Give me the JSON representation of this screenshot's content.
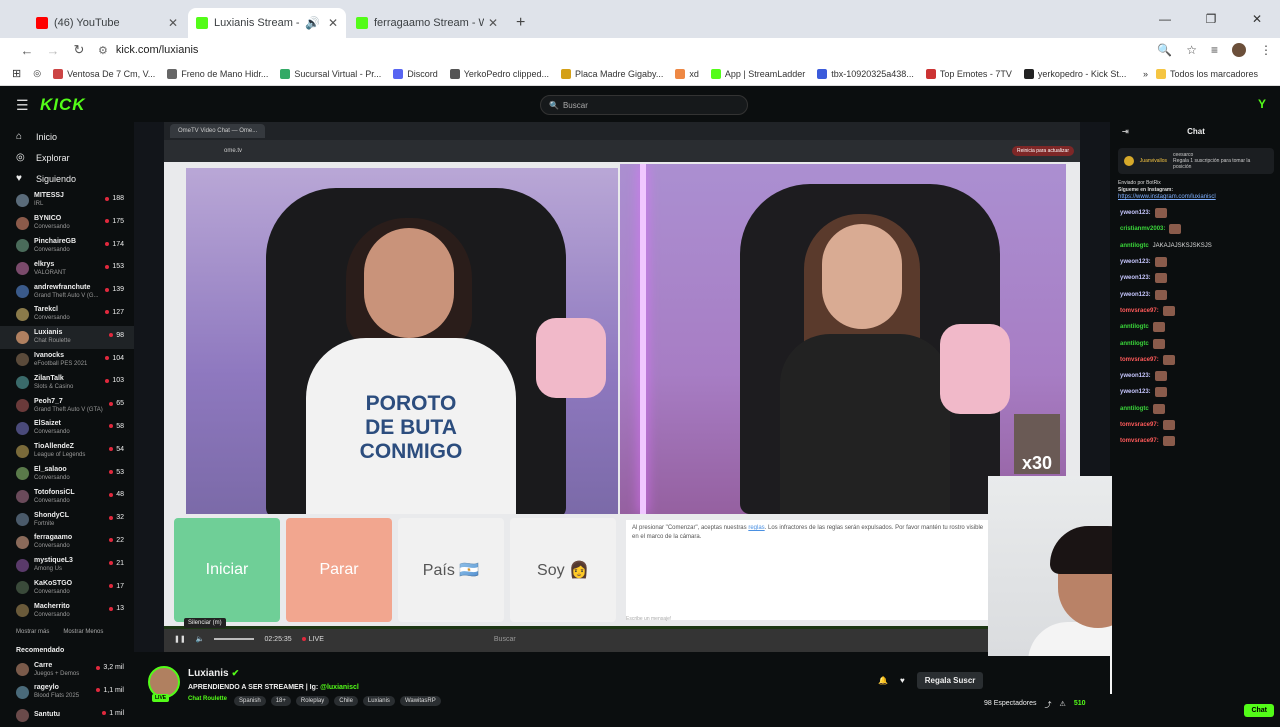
{
  "tabs": [
    {
      "label": "(46) YouTube",
      "color": "#ff0000"
    },
    {
      "label": "Luxianis Stream - Watch Live",
      "color": "#53fc18"
    },
    {
      "label": "ferragaamo Stream - Watch Live",
      "color": "#53fc18"
    }
  ],
  "toolbar": {
    "url": "kick.com/luxianis"
  },
  "bookmarks": [
    "Ventosa De 7 Cm, V...",
    "Freno de Mano Hidr...",
    "Sucursal Virtual - Pr...",
    "Discord",
    "YerkoPedro clipped...",
    "Placa Madre Gigaby...",
    "xd",
    "App | StreamLadder",
    "tbx-10920325a438...",
    "Top Emotes - 7TV",
    "yerkopedro - Kick St..."
  ],
  "bookmarks_all": "Todos los marcadores",
  "kick": {
    "logo": "KICK",
    "search_placeholder": "Buscar"
  },
  "sidebar": {
    "nav": [
      {
        "label": "Inicio",
        "icon": "⌂"
      },
      {
        "label": "Explorar",
        "icon": "◎"
      },
      {
        "label": "Siguiendo",
        "icon": "♥"
      }
    ],
    "channels": [
      {
        "name": "MITESSJ",
        "cat": "IRL",
        "viewers": "188",
        "color": "#5a6b7a"
      },
      {
        "name": "BYNICO",
        "cat": "Conversando",
        "viewers": "175",
        "color": "#8b5a4a"
      },
      {
        "name": "PinchaireGB",
        "cat": "Conversando",
        "viewers": "174",
        "color": "#4a6b5a"
      },
      {
        "name": "elkrys",
        "cat": "VALORANT",
        "viewers": "153",
        "color": "#7a4a6b"
      },
      {
        "name": "andrewfranchute",
        "cat": "Grand Theft Auto V (G...",
        "viewers": "139",
        "color": "#3a5a8a"
      },
      {
        "name": "Tarekcl",
        "cat": "Conversando",
        "viewers": "127",
        "color": "#8a7a4a"
      },
      {
        "name": "Luxianis",
        "cat": "Chat Roulette",
        "viewers": "98",
        "color": "#b08060"
      },
      {
        "name": "Ivanocks",
        "cat": "eFootball PES 2021",
        "viewers": "104",
        "color": "#5a4a3a"
      },
      {
        "name": "ZilanTalk",
        "cat": "Slots & Casino",
        "viewers": "103",
        "color": "#3a6a6a"
      },
      {
        "name": "Peoh7_7",
        "cat": "Grand Theft Auto V (GTA)",
        "viewers": "65",
        "color": "#6a3a3a"
      },
      {
        "name": "ElSaizet",
        "cat": "Conversando",
        "viewers": "58",
        "color": "#4a4a7a"
      },
      {
        "name": "TioAllendeZ",
        "cat": "League of Legends",
        "viewers": "54",
        "color": "#7a6a3a"
      },
      {
        "name": "El_salaoo",
        "cat": "Conversando",
        "viewers": "53",
        "color": "#5a7a4a"
      },
      {
        "name": "TotofonsiCL",
        "cat": "Conversando",
        "viewers": "48",
        "color": "#6a4a5a"
      },
      {
        "name": "ShondyCL",
        "cat": "Fortnite",
        "viewers": "32",
        "color": "#4a5a6a"
      },
      {
        "name": "ferragaamo",
        "cat": "Conversando",
        "viewers": "22",
        "color": "#8a6a5a"
      },
      {
        "name": "mystiqueL3",
        "cat": "Among Us",
        "viewers": "21",
        "color": "#5a3a6a"
      },
      {
        "name": "KaKoSTGO",
        "cat": "Conversando",
        "viewers": "17",
        "color": "#3a4a3a"
      },
      {
        "name": "Macherrito",
        "cat": "Conversando",
        "viewers": "13",
        "color": "#6a5a3a"
      }
    ],
    "show_more": "Mostrar más",
    "show_less": "Mostrar Menos",
    "recommended_title": "Recomendado",
    "recommended": [
      {
        "name": "Carre",
        "cat": "Juegos + Demos",
        "viewers": "3,2 mil",
        "color": "#7a5a4a"
      },
      {
        "name": "rageylo",
        "cat": "Blood Flats 2025",
        "viewers": "1,1 mil",
        "color": "#4a6a7a"
      },
      {
        "name": "Santutu",
        "cat": "",
        "viewers": "1 mil",
        "color": "#6a4a4a"
      }
    ]
  },
  "video": {
    "inner_tab": "OmeTV Video Chat — Ome...",
    "inner_url": "ome.tv",
    "inner_pill": "Reinicia para actualizar",
    "hoodie": "POROTO\nDE BUTA\nCONMIGO",
    "x30": "x30",
    "buttons": {
      "start": "Iniciar",
      "stop": "Parar",
      "country": "País 🇦🇷",
      "me": "Soy 👩"
    },
    "notice_a": "Al presionar \"Comenzar\", aceptas nuestras ",
    "notice_link": "reglas",
    "notice_b": ". Los infractores de las reglas serán expulsados. Por favor mantén tu rostro visible en el marco de la cámara.",
    "msg_placeholder": "Escribe un mensaje!",
    "tooltip": "Silenciar (m)",
    "time": "02:25:35",
    "live": "LIVE",
    "taskbar_search": "Buscar",
    "progress": 0.9
  },
  "stream": {
    "name": "Luxianis",
    "live": "LIVE",
    "title": "APRENDIENDO A SER STREAMER | Ig: ",
    "ig": "@luxianiscl",
    "category": "Chat Roulette",
    "tags": [
      "Spanish",
      "18+",
      "Roleplay",
      "Chile",
      "Luxianis",
      "WawitasRP"
    ],
    "gift": "Regala Suscr",
    "viewers": "98 Espectadores",
    "likes": "510"
  },
  "chat": {
    "title": "Chat",
    "sub_user": "Juanvivallos",
    "sub_user2": "ceesarco",
    "sub_text": "Regala 1 suscripción para tomar la posición",
    "pinned_by": "Enviado por  BotRix",
    "pinned_text": "Sígueme en Instagram:",
    "pinned_link": "https://www.instagram.com/luxianiscl",
    "messages": [
      {
        "user": "yweon123:",
        "color": "#c7c7ff",
        "text": ""
      },
      {
        "user": "cristianmv2003:",
        "color": "#3ad63a",
        "text": ""
      },
      {
        "user": "anntilogtc",
        "color": "#3ad63a",
        "text": "JAKAJAJSKSJSKSJS"
      },
      {
        "user": "yweon123:",
        "color": "#c7c7ff",
        "text": ""
      },
      {
        "user": "yweon123:",
        "color": "#c7c7ff",
        "text": ""
      },
      {
        "user": "yweon123:",
        "color": "#c7c7ff",
        "text": ""
      },
      {
        "user": "tomvsrace97:",
        "color": "#ff5a5a",
        "text": ""
      },
      {
        "user": "anntilogtc",
        "color": "#3ad63a",
        "text": ""
      },
      {
        "user": "anntilogtc",
        "color": "#3ad63a",
        "text": ""
      },
      {
        "user": "tomvsrace97:",
        "color": "#ff5a5a",
        "text": ""
      },
      {
        "user": "yweon123:",
        "color": "#c7c7ff",
        "text": ""
      },
      {
        "user": "yweon123:",
        "color": "#c7c7ff",
        "text": ""
      },
      {
        "user": "anntilogtc",
        "color": "#3ad63a",
        "text": ""
      },
      {
        "user": "tomvsrace97:",
        "color": "#ff5a5a",
        "text": ""
      },
      {
        "user": "tomvsrace97:",
        "color": "#ff5a5a",
        "text": ""
      }
    ],
    "chat_button": "Chat"
  }
}
